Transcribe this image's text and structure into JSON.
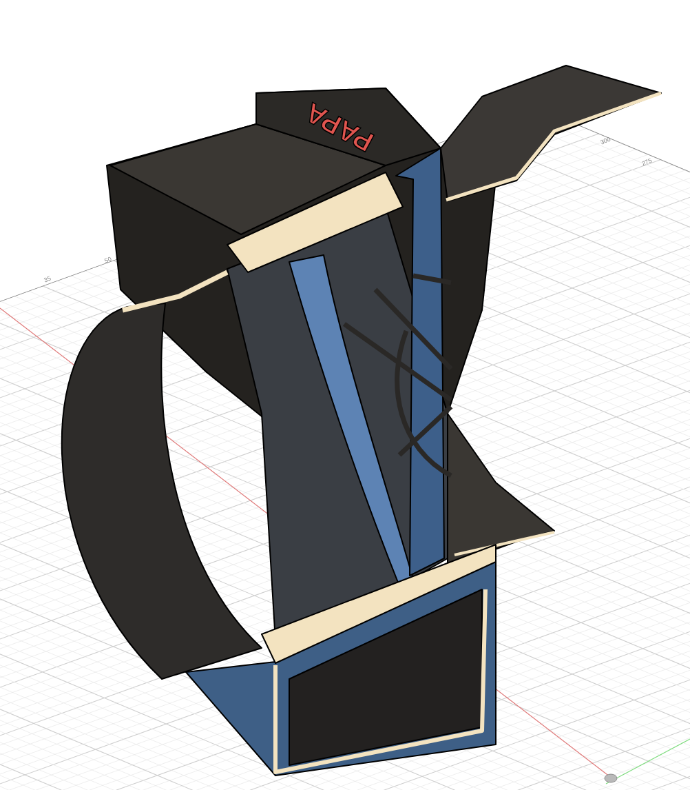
{
  "viewport": {
    "grid_labels": [
      "300",
      "275",
      "35",
      "50"
    ],
    "model_label": "PAPA"
  }
}
